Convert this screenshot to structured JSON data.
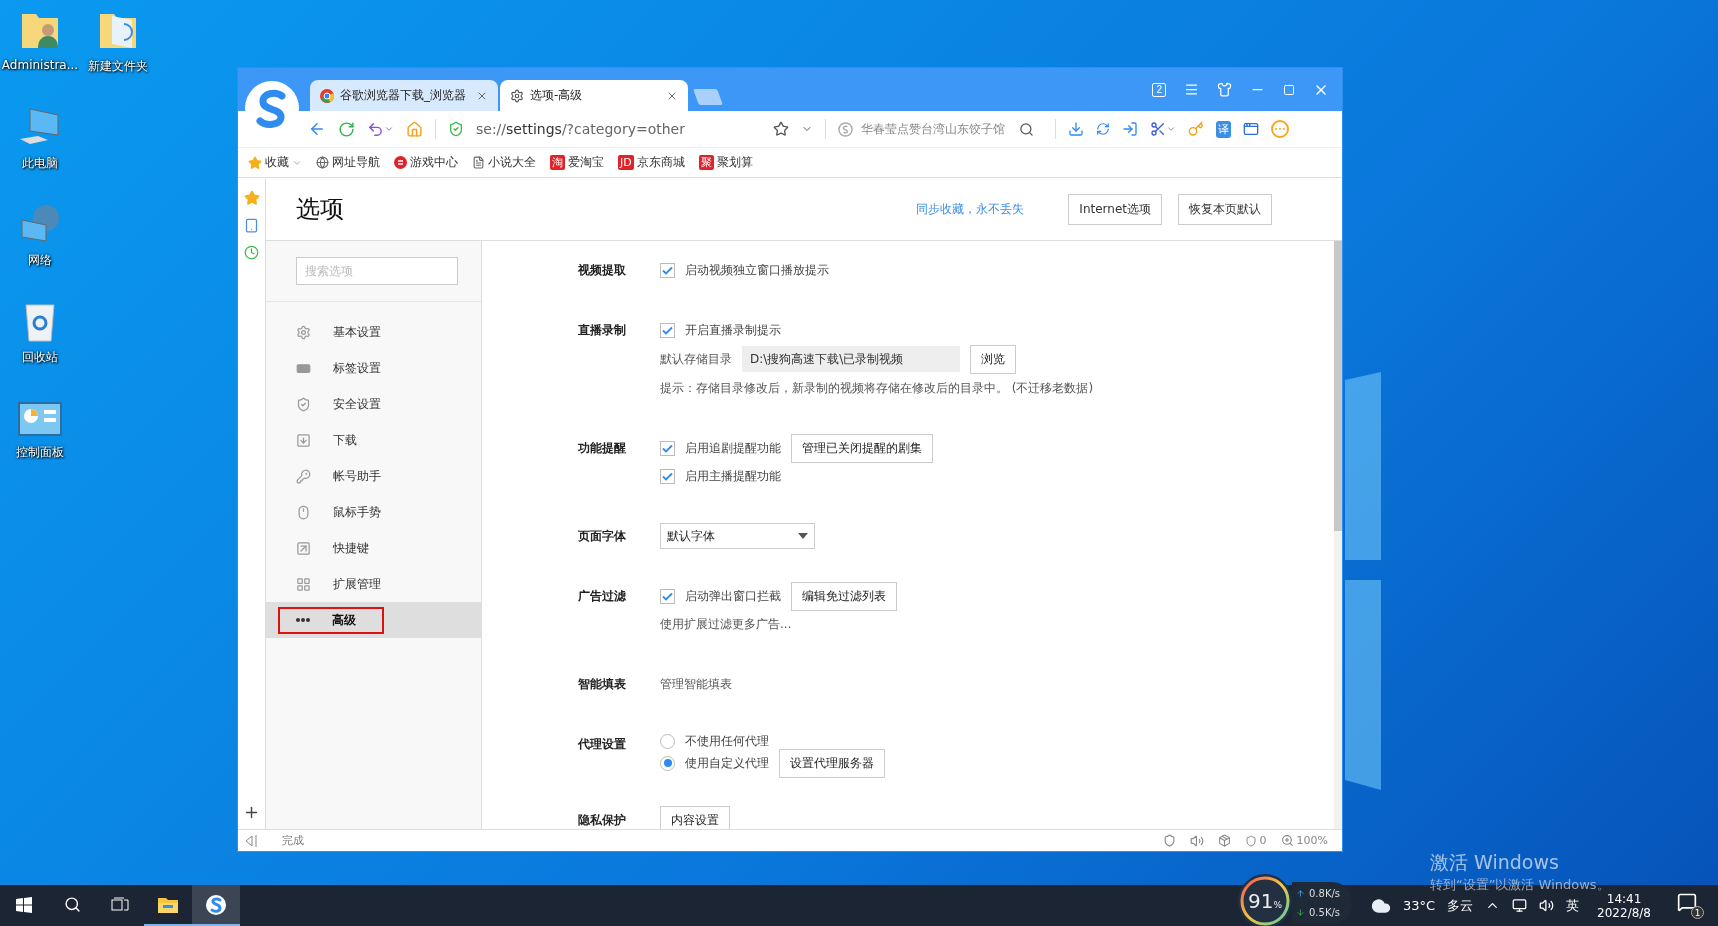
{
  "desktop": {
    "icons": [
      {
        "label": "Administra...",
        "kind": "user-folder"
      },
      {
        "label": "新建文件夹",
        "kind": "folder"
      },
      {
        "label": "此电脑",
        "kind": "computer"
      },
      {
        "label": "网络",
        "kind": "network"
      },
      {
        "label": "回收站",
        "kind": "recycle"
      },
      {
        "label": "控制面板",
        "kind": "control-panel"
      }
    ],
    "activation": {
      "title": "激活 Windows",
      "subtitle": "转到“设置”以激活 Windows。"
    }
  },
  "browser": {
    "tabs": [
      {
        "title": "谷歌浏览器下载_浏览器",
        "kind": "chrome",
        "selected": false
      },
      {
        "title": "选项-高级",
        "kind": "settings",
        "selected": true
      }
    ],
    "window_count": "2",
    "url": "se://**settings**/?category=other",
    "search": {
      "placeholder": "华春莹点赞台湾山东饺子馆"
    },
    "translate": "译",
    "bookmarks": [
      {
        "label": "收藏",
        "kind": "star"
      },
      {
        "label": "网址导航",
        "kind": "globe"
      },
      {
        "label": "游戏中心",
        "kind": "game"
      },
      {
        "label": "小说大全",
        "kind": "book"
      },
      {
        "label": "爱淘宝",
        "kind": "badge",
        "badge": "淘"
      },
      {
        "label": "京东商城",
        "kind": "badge",
        "badge": "JD"
      },
      {
        "label": "聚划算",
        "kind": "badge",
        "badge": "聚"
      }
    ],
    "status": {
      "text": "完成",
      "ad_count": "0",
      "zoom": "100%"
    }
  },
  "page": {
    "title": "选项",
    "sync_link": "同步收藏，永不丢失",
    "header_buttons": [
      "Internet选项",
      "恢复本页默认"
    ],
    "nav_search": {
      "placeholder": "搜索选项"
    },
    "nav": [
      {
        "label": "基本设置",
        "kind": "gear",
        "selected": false
      },
      {
        "label": "标签设置",
        "kind": "tab",
        "selected": false
      },
      {
        "label": "安全设置",
        "kind": "shield",
        "selected": false
      },
      {
        "label": "下载",
        "kind": "download",
        "selected": false
      },
      {
        "label": "帐号助手",
        "kind": "key",
        "selected": false
      },
      {
        "label": "鼠标手势",
        "kind": "mouse",
        "selected": false
      },
      {
        "label": "快捷键",
        "kind": "shortcut",
        "selected": false
      },
      {
        "label": "扩展管理",
        "kind": "grid",
        "selected": false
      },
      {
        "label": "高级",
        "kind": "more",
        "selected": true
      }
    ],
    "sections": [
      {
        "label": "视频提取",
        "rows": [
          {
            "kind": "checkbox",
            "label": "启动视频独立窗口播放提示",
            "checked": true
          }
        ]
      },
      {
        "label": "直播录制",
        "rows": [
          {
            "kind": "checkbox",
            "label": "开启直播录制提示",
            "checked": true
          },
          {
            "kind": "path",
            "label": "默认存储目录",
            "value": "D:\\搜狗高速下载\\已录制视频",
            "button": "浏览"
          },
          {
            "kind": "note",
            "text": "提示：存储目录修改后，新录制的视频将存储在修改后的目录中。 (不迁移老数据)"
          }
        ]
      },
      {
        "label": "功能提醒",
        "rows": [
          {
            "kind": "checkbox",
            "label": "启用追剧提醒功能",
            "checked": true,
            "button": "管理已关闭提醒的剧集"
          },
          {
            "kind": "checkbox",
            "label": "启用主播提醒功能",
            "checked": true
          }
        ]
      },
      {
        "label": "页面字体",
        "rows": [
          {
            "kind": "select",
            "value": "默认字体"
          }
        ]
      },
      {
        "label": "广告过滤",
        "rows": [
          {
            "kind": "checkbox",
            "label": "启动弹出窗口拦截",
            "checked": true,
            "button": "编辑免过滤列表"
          },
          {
            "kind": "note",
            "text": "使用扩展过滤更多广告..."
          }
        ]
      },
      {
        "label": "智能填表",
        "rows": [
          {
            "kind": "note",
            "text": "管理智能填表"
          }
        ]
      },
      {
        "label": "代理设置",
        "rows": [
          {
            "kind": "radio",
            "label": "不使用任何代理",
            "selected": false
          },
          {
            "kind": "radio",
            "label": "使用自定义代理",
            "selected": true,
            "button": "设置代理服务器"
          }
        ]
      },
      {
        "label": "隐私保护",
        "rows": [
          {
            "kind": "button",
            "label": "内容设置"
          }
        ]
      }
    ]
  },
  "taskbar": {
    "apps": [
      {
        "kind": "explorer",
        "selected": false
      },
      {
        "kind": "sogou",
        "selected": true
      }
    ],
    "gauge": {
      "value": "91",
      "unit": "%"
    },
    "upload": "0.8",
    "upload_unit": "K/s",
    "download": "0.5",
    "download_unit": "K/s",
    "weather": {
      "temp": "33°C",
      "desc": "多云"
    },
    "ime": "英",
    "time": "14:41",
    "date": "2022/8/8",
    "notifications": "1"
  }
}
